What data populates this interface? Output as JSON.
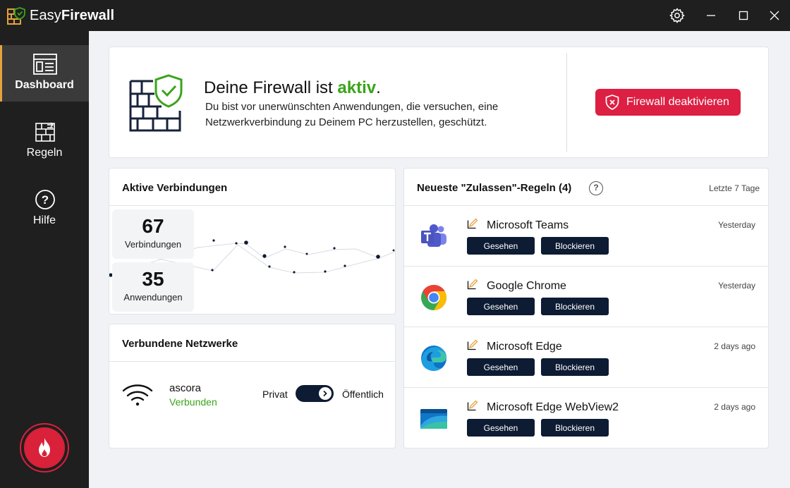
{
  "app": {
    "title_regular": "Easy",
    "title_bold": "Firewall"
  },
  "window": {
    "settings_icon": "gear-icon",
    "minimize_icon": "minimize-icon",
    "maximize_icon": "maximize-icon",
    "close_icon": "close-icon"
  },
  "sidebar": {
    "items": [
      {
        "label": "Dashboard",
        "icon": "dashboard-icon",
        "active": true
      },
      {
        "label": "Regeln",
        "icon": "rules-icon",
        "active": false
      },
      {
        "label": "Hilfe",
        "icon": "help-icon",
        "active": false
      }
    ],
    "fire_button_icon": "flame-icon"
  },
  "status": {
    "title_prefix": "Deine Firewall ist ",
    "title_state": "aktiv",
    "title_suffix": ".",
    "description": "Du bist vor unerwünschten Anwendungen, die versuchen, eine Netzwerkverbindung zu Deinem PC herzustellen, geschützt.",
    "deactivate_label": "Firewall deaktivieren"
  },
  "connections": {
    "title": "Aktive Verbindungen",
    "connections_count": "67",
    "connections_label": "Verbindungen",
    "apps_count": "35",
    "apps_label": "Anwendungen"
  },
  "networks": {
    "title": "Verbundene Netzwerke",
    "name": "ascora",
    "status": "Verbunden",
    "private_label": "Privat",
    "public_label": "Öffentlich",
    "mode": "Öffentlich"
  },
  "rules": {
    "title": "Neueste \"Zulassen\"-Regeln (4)",
    "period": "Letzte 7 Tage",
    "seen_label": "Gesehen",
    "block_label": "Blockieren",
    "items": [
      {
        "name": "Microsoft Teams",
        "time": "Yesterday",
        "icon": "teams-icon"
      },
      {
        "name": "Google Chrome",
        "time": "Yesterday",
        "icon": "chrome-icon"
      },
      {
        "name": "Microsoft Edge",
        "time": "2 days ago",
        "icon": "edge-icon"
      },
      {
        "name": "Microsoft Edge WebView2",
        "time": "2 days ago",
        "icon": "webview2-icon"
      }
    ]
  },
  "colors": {
    "accent_green": "#3aa41a",
    "danger_red": "#dc1f43",
    "button_navy": "#0d1b33",
    "nav_accent": "#e6a23c"
  }
}
